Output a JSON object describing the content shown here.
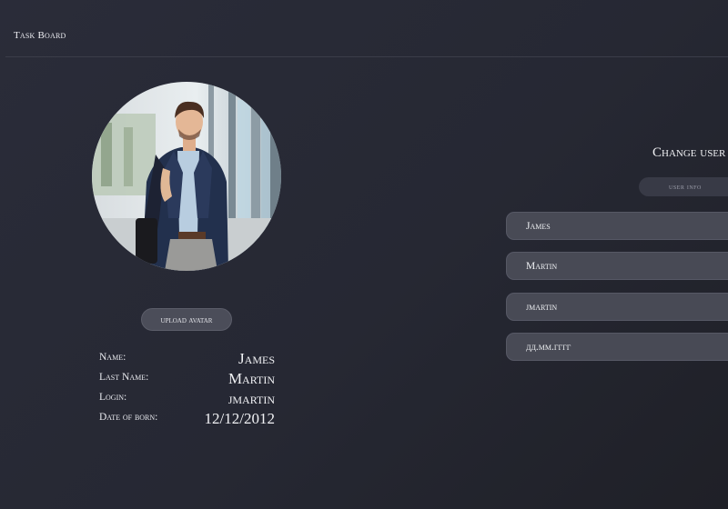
{
  "app": {
    "title": "Task Board"
  },
  "avatar": {
    "alt": "Profile photo"
  },
  "upload_label": "upload avatar",
  "profile": {
    "name_label": "Name:",
    "name_value": "James",
    "lastname_label": "Last Name:",
    "lastname_value": "Martin",
    "login_label": "Login:",
    "login_value": "jmartin",
    "dob_label": "Date of born:",
    "dob_value": "12/12/2012"
  },
  "form": {
    "title": "Change user",
    "tab_label": "user info",
    "fields": {
      "first_name": "James",
      "last_name": "Martin",
      "login": "jmartin",
      "dob_placeholder": "дд.мм.гггг"
    }
  },
  "colors": {
    "background": "#282a35",
    "field": "#484a55",
    "button": "#4b4d59"
  }
}
